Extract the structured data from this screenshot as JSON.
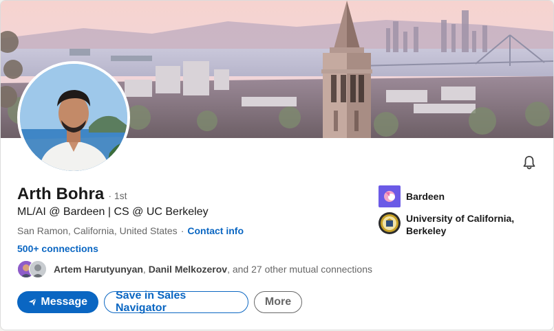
{
  "profile": {
    "name": "Arth Bohra",
    "degree": "· 1st",
    "headline": "ML/AI @ Bardeen | CS @ UC Berkeley",
    "location": "San Ramon, California, United States",
    "separator": "·",
    "contact_info": "Contact info",
    "connections": "500+ connections"
  },
  "mutual": {
    "name1": "Artem Harutyunyan",
    "comma": ",",
    "name2": "Danil Melkozerov",
    "rest": ", and 27 other mutual connections"
  },
  "actions": {
    "message": "Message",
    "sales_navigator": "Save in Sales Navigator",
    "more": "More"
  },
  "organizations": [
    {
      "name": "Bardeen",
      "icon": "bardeen-logo"
    },
    {
      "name": "University of California, Berkeley",
      "icon": "uc-berkeley-seal"
    }
  ],
  "icons": {
    "notifications": "bell-icon",
    "message": "send-icon"
  },
  "colors": {
    "accent": "#0a66c2",
    "text": "#191919",
    "muted": "#666666"
  }
}
